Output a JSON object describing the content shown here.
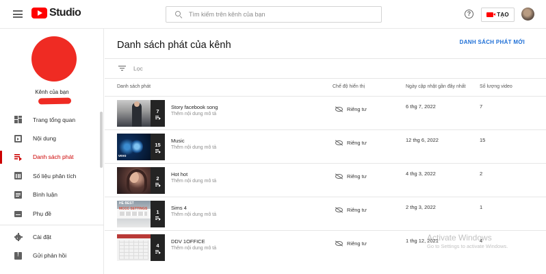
{
  "topbar": {
    "logo_text": "Studio",
    "search_placeholder": "Tìm kiếm trên kênh của bạn",
    "help_glyph": "?",
    "create_label": "TẠO"
  },
  "sidebar": {
    "channel_label": "Kênh của bạn",
    "items": [
      {
        "label": "Trang tổng quan",
        "icon": "dashboard-icon",
        "active": false
      },
      {
        "label": "Nội dung",
        "icon": "content-icon",
        "active": false
      },
      {
        "label": "Danh sách phát",
        "icon": "playlist-icon",
        "active": true
      },
      {
        "label": "Số liệu phân tích",
        "icon": "analytics-icon",
        "active": false
      },
      {
        "label": "Bình luận",
        "icon": "comments-icon",
        "active": false
      },
      {
        "label": "Phụ đề",
        "icon": "subtitles-icon",
        "active": false
      }
    ],
    "bottom_items": [
      {
        "label": "Cài đặt",
        "icon": "gear-icon"
      },
      {
        "label": "Gửi phản hồi",
        "icon": "feedback-icon"
      }
    ]
  },
  "main": {
    "title": "Danh sách phát của kênh",
    "new_playlist_label": "DANH SÁCH PHÁT MỚI",
    "filter_label": "Lọc",
    "columns": {
      "playlist": "Danh sách phát",
      "visibility": "Chế độ hiển thị",
      "updated": "Ngày cập nhật gần đây nhất",
      "video_count": "Số lượng video"
    },
    "rows": [
      {
        "title": "Story facebook song",
        "description": "Thêm nội dung mô tả",
        "thumb_count": "7",
        "visibility": "Riêng tư",
        "updated": "6 thg 7, 2022",
        "video_count": "7"
      },
      {
        "title": "Music",
        "description": "Thêm nội dung mô tả",
        "thumb_count": "15",
        "visibility": "Riêng tư",
        "updated": "12 thg 6, 2022",
        "video_count": "15",
        "thumb_caption": "vevo"
      },
      {
        "title": "Hot hot",
        "description": "Thêm nội dung mô tả",
        "thumb_count": "2",
        "visibility": "Riêng tư",
        "updated": "4 thg 3, 2022",
        "video_count": "2"
      },
      {
        "title": "Sims 4",
        "description": "Thêm nội dung mô tả",
        "thumb_count": "1",
        "visibility": "Riêng tư",
        "updated": "2 thg 3, 2022",
        "video_count": "1",
        "thumb_caption": "HE BEST",
        "thumb_caption_2": "MCCC SETTINGS"
      },
      {
        "title": "DDV 1OFFICE",
        "description": "Thêm nội dung mô tả",
        "thumb_count": "4",
        "visibility": "Riêng tư",
        "updated": "1 thg 12, 2021",
        "video_count": "4"
      }
    ]
  },
  "watermark": {
    "line1": "Activate Windows",
    "line2": "Go to Settings to activate Windows."
  },
  "colors": {
    "brand_red": "#ff0000",
    "active_red": "#cc0000",
    "link_blue": "#1e6fd6"
  }
}
